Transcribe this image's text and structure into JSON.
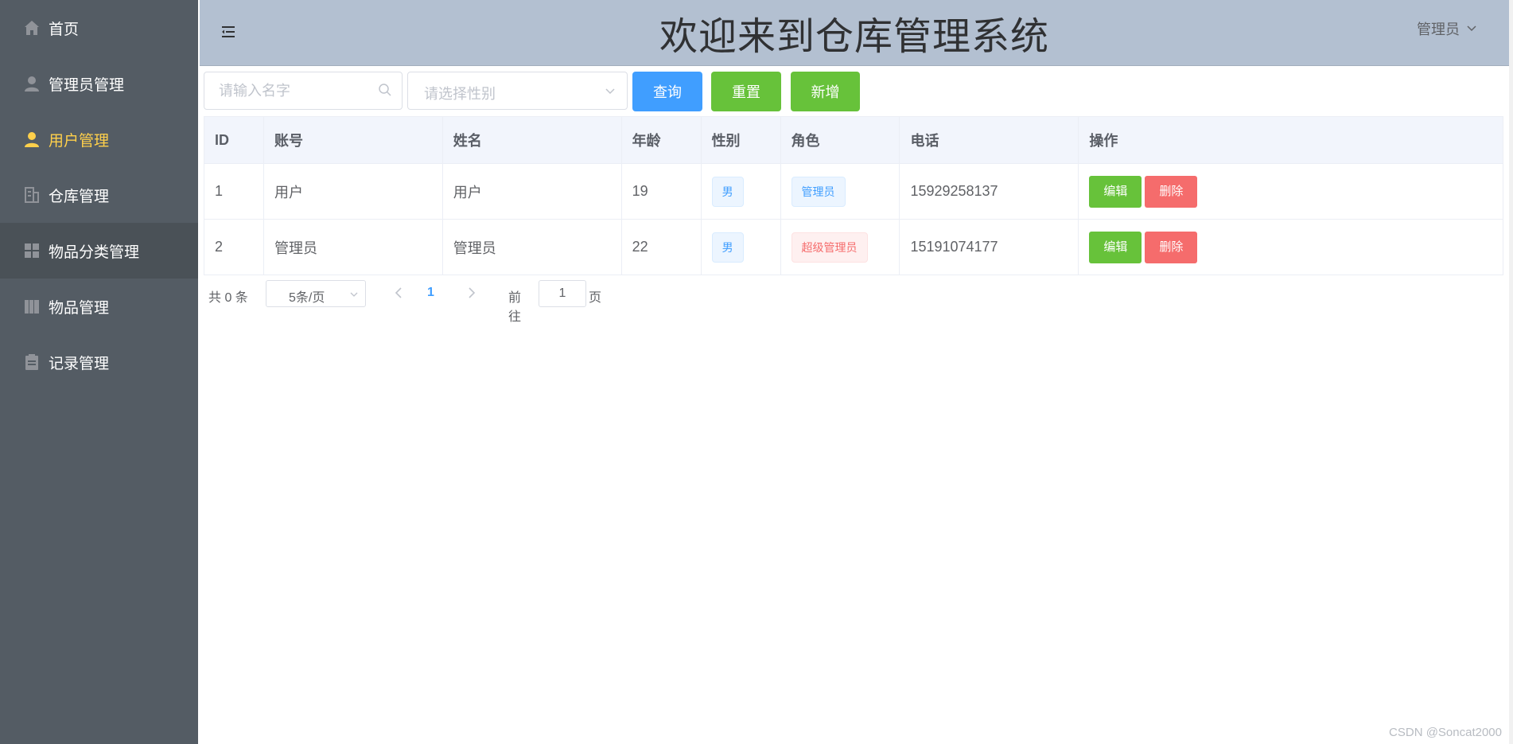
{
  "sidebar": {
    "items": [
      {
        "label": "首页",
        "icon": "home-icon"
      },
      {
        "label": "管理员管理",
        "icon": "user-icon"
      },
      {
        "label": "用户管理",
        "icon": "user-solid-icon",
        "active": true
      },
      {
        "label": "仓库管理",
        "icon": "office-building-icon"
      },
      {
        "label": "物品分类管理",
        "icon": "grid-icon",
        "hover": true
      },
      {
        "label": "物品管理",
        "icon": "collection-icon"
      },
      {
        "label": "记录管理",
        "icon": "clipboard-icon"
      }
    ],
    "colors": {
      "background": "#545c64",
      "active_text": "#ffd04b",
      "text": "#ffffff"
    }
  },
  "header": {
    "title": "欢迎来到仓库管理系统",
    "user_label": "管理员"
  },
  "toolbar": {
    "name_placeholder": "请输入名字",
    "gender_placeholder": "请选择性别",
    "query_label": "查询",
    "reset_label": "重置",
    "add_label": "新增"
  },
  "table": {
    "columns": [
      "ID",
      "账号",
      "姓名",
      "年龄",
      "性别",
      "角色",
      "电话",
      "操作"
    ],
    "rows": [
      {
        "id": "1",
        "account": "用户",
        "name": "用户",
        "age": "19",
        "gender": "男",
        "role": "管理员",
        "role_type": "blue",
        "phone": "15929258137"
      },
      {
        "id": "2",
        "account": "管理员",
        "name": "管理员",
        "age": "22",
        "gender": "男",
        "role": "超级管理员",
        "role_type": "red",
        "phone": "15191074177"
      }
    ],
    "edit_label": "编辑",
    "delete_label": "删除"
  },
  "pagination": {
    "total_text": "共 0 条",
    "page_size": "5条/页",
    "current_page": "1",
    "goto_label": "前往",
    "goto_value": "1",
    "page_suffix": "页"
  },
  "watermark": "CSDN @Soncat2000",
  "colors": {
    "primary": "#409eff",
    "success": "#67c23a",
    "danger": "#f56c6c",
    "header_bg": "#b3c0d1"
  }
}
